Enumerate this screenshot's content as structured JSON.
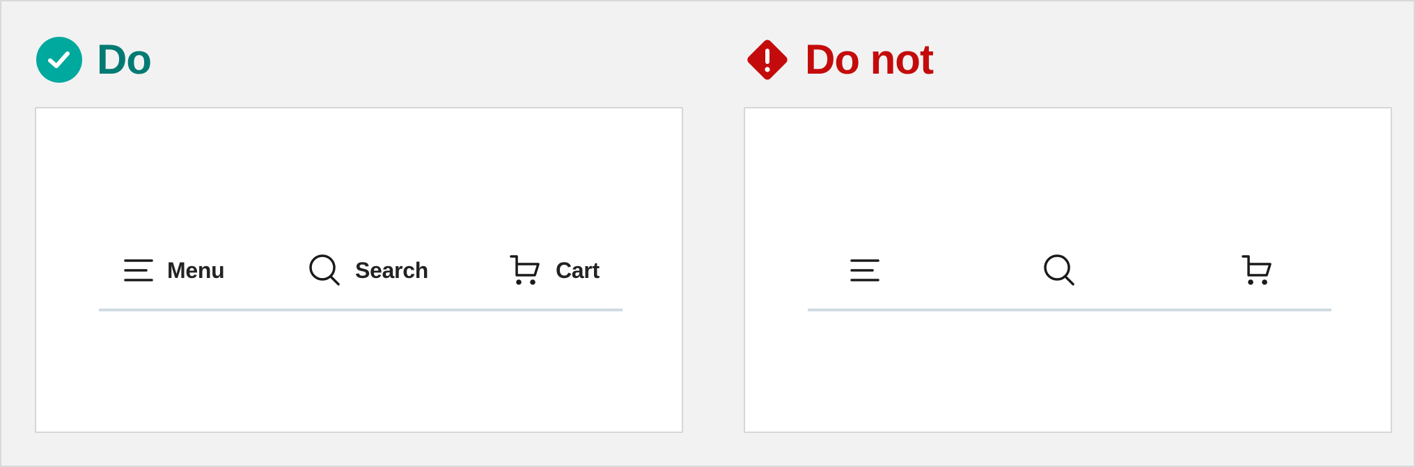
{
  "colors": {
    "do_accent": "#00a99d",
    "do_text": "#007a73",
    "dont_accent": "#c40b0b",
    "icon_stroke": "#1a1a1a",
    "divider": "#cfdce2"
  },
  "do": {
    "title": "Do",
    "status_icon": "check-circle-icon",
    "nav_items": [
      {
        "icon": "menu-icon",
        "label": "Menu"
      },
      {
        "icon": "search-icon",
        "label": "Search"
      },
      {
        "icon": "cart-icon",
        "label": "Cart"
      }
    ]
  },
  "dont": {
    "title": "Do not",
    "status_icon": "warning-diamond-icon",
    "nav_items": [
      {
        "icon": "menu-icon",
        "label": ""
      },
      {
        "icon": "search-icon",
        "label": ""
      },
      {
        "icon": "cart-icon",
        "label": ""
      }
    ]
  }
}
